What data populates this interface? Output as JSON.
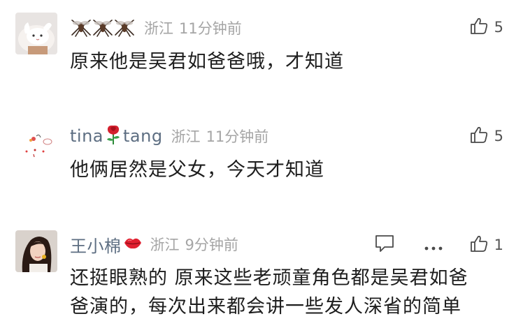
{
  "comments": [
    {
      "name": "",
      "name_emoji": "mosquito-emoji-x3",
      "location": "浙江",
      "time": "11分钟前",
      "content": "原来他是吴君如爸爸哦，才知道",
      "likes": "5"
    },
    {
      "name_part1": "tina",
      "name_emoji": "rose-emoji",
      "name_part2": "tang",
      "location": "浙江",
      "time": "11分钟前",
      "content": "他俩居然是父女，今天才知道",
      "likes": "5"
    },
    {
      "name": "王小棉",
      "name_emoji": "kiss-lips-emoji",
      "location": "浙江",
      "time": "9分钟前",
      "content_line1": "还挺眼熟的 原来这些老顽童角色都是吴君如爸",
      "content_line2": "爸演的，每次出来都会讲一些发人深省的简单",
      "likes": "1"
    }
  ],
  "icons": {
    "like": "thumbs-up-icon",
    "reply": "reply-bubble-icon",
    "more": "more-dots-icon"
  },
  "colors": {
    "username": "#5d6e82",
    "meta": "#a5a5a5",
    "content": "#1d1d1d",
    "icon": "#4a4a4a"
  }
}
